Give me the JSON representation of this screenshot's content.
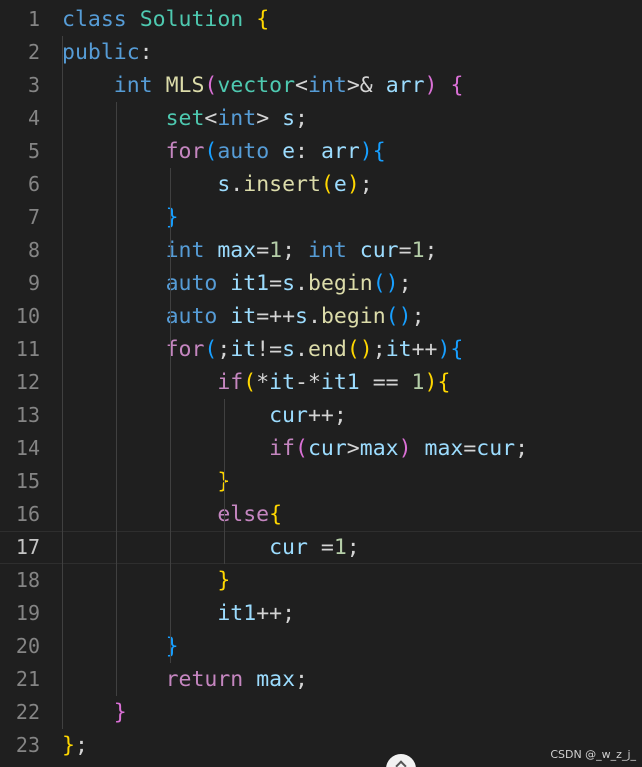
{
  "editor": {
    "current_line": 17,
    "lines": [
      {
        "n": "1",
        "tokens": [
          [
            "kw",
            "class"
          ],
          [
            "plain",
            " "
          ],
          [
            "ty",
            "Solution"
          ],
          [
            "plain",
            " "
          ],
          [
            "br1",
            "{"
          ]
        ]
      },
      {
        "n": "2",
        "tokens": [
          [
            "kw",
            "public"
          ],
          [
            "plain",
            ":"
          ]
        ]
      },
      {
        "n": "3",
        "tokens": [
          [
            "plain",
            "    "
          ],
          [
            "kw",
            "int"
          ],
          [
            "plain",
            " "
          ],
          [
            "fn",
            "MLS"
          ],
          [
            "br2",
            "("
          ],
          [
            "ty",
            "vector"
          ],
          [
            "plain",
            "<"
          ],
          [
            "kw",
            "int"
          ],
          [
            "plain",
            ">& "
          ],
          [
            "var",
            "arr"
          ],
          [
            "br2",
            ")"
          ],
          [
            "plain",
            " "
          ],
          [
            "br2",
            "{"
          ]
        ]
      },
      {
        "n": "4",
        "tokens": [
          [
            "plain",
            "        "
          ],
          [
            "ty",
            "set"
          ],
          [
            "plain",
            "<"
          ],
          [
            "kw",
            "int"
          ],
          [
            "plain",
            "> "
          ],
          [
            "var",
            "s"
          ],
          [
            "plain",
            ";"
          ]
        ]
      },
      {
        "n": "5",
        "tokens": [
          [
            "plain",
            "        "
          ],
          [
            "ctl",
            "for"
          ],
          [
            "br3",
            "("
          ],
          [
            "kw",
            "auto"
          ],
          [
            "plain",
            " "
          ],
          [
            "var",
            "e"
          ],
          [
            "plain",
            ": "
          ],
          [
            "var",
            "arr"
          ],
          [
            "br3",
            ")"
          ],
          [
            "br3",
            "{"
          ]
        ]
      },
      {
        "n": "6",
        "tokens": [
          [
            "plain",
            "            "
          ],
          [
            "var",
            "s"
          ],
          [
            "plain",
            "."
          ],
          [
            "fn",
            "insert"
          ],
          [
            "br1",
            "("
          ],
          [
            "var",
            "e"
          ],
          [
            "br1",
            ")"
          ],
          [
            "plain",
            ";"
          ]
        ]
      },
      {
        "n": "7",
        "tokens": [
          [
            "plain",
            "        "
          ],
          [
            "br3",
            "}"
          ]
        ]
      },
      {
        "n": "8",
        "tokens": [
          [
            "plain",
            "        "
          ],
          [
            "kw",
            "int"
          ],
          [
            "plain",
            " "
          ],
          [
            "var",
            "max"
          ],
          [
            "plain",
            "="
          ],
          [
            "num",
            "1"
          ],
          [
            "plain",
            "; "
          ],
          [
            "kw",
            "int"
          ],
          [
            "plain",
            " "
          ],
          [
            "var",
            "cur"
          ],
          [
            "plain",
            "="
          ],
          [
            "num",
            "1"
          ],
          [
            "plain",
            ";"
          ]
        ]
      },
      {
        "n": "9",
        "tokens": [
          [
            "plain",
            "        "
          ],
          [
            "kw",
            "auto"
          ],
          [
            "plain",
            " "
          ],
          [
            "var",
            "it1"
          ],
          [
            "plain",
            "="
          ],
          [
            "var",
            "s"
          ],
          [
            "plain",
            "."
          ],
          [
            "fn",
            "begin"
          ],
          [
            "br3",
            "()"
          ],
          [
            "plain",
            ";"
          ]
        ]
      },
      {
        "n": "10",
        "tokens": [
          [
            "plain",
            "        "
          ],
          [
            "kw",
            "auto"
          ],
          [
            "plain",
            " "
          ],
          [
            "var",
            "it"
          ],
          [
            "plain",
            "=++"
          ],
          [
            "var",
            "s"
          ],
          [
            "plain",
            "."
          ],
          [
            "fn",
            "begin"
          ],
          [
            "br3",
            "()"
          ],
          [
            "plain",
            ";"
          ]
        ]
      },
      {
        "n": "11",
        "tokens": [
          [
            "plain",
            "        "
          ],
          [
            "ctl",
            "for"
          ],
          [
            "br3",
            "("
          ],
          [
            "plain",
            ";"
          ],
          [
            "var",
            "it"
          ],
          [
            "plain",
            "!="
          ],
          [
            "var",
            "s"
          ],
          [
            "plain",
            "."
          ],
          [
            "fn",
            "end"
          ],
          [
            "br1",
            "()"
          ],
          [
            "plain",
            ";"
          ],
          [
            "var",
            "it"
          ],
          [
            "plain",
            "++"
          ],
          [
            "br3",
            ")"
          ],
          [
            "br3",
            "{"
          ]
        ]
      },
      {
        "n": "12",
        "tokens": [
          [
            "plain",
            "            "
          ],
          [
            "ctl",
            "if"
          ],
          [
            "br1",
            "("
          ],
          [
            "plain",
            "*"
          ],
          [
            "var",
            "it"
          ],
          [
            "plain",
            "-*"
          ],
          [
            "var",
            "it1"
          ],
          [
            "plain",
            " == "
          ],
          [
            "num",
            "1"
          ],
          [
            "br1",
            ")"
          ],
          [
            "br1",
            "{"
          ]
        ]
      },
      {
        "n": "13",
        "tokens": [
          [
            "plain",
            "                "
          ],
          [
            "var",
            "cur"
          ],
          [
            "plain",
            "++;"
          ]
        ]
      },
      {
        "n": "14",
        "tokens": [
          [
            "plain",
            "                "
          ],
          [
            "ctl",
            "if"
          ],
          [
            "br2",
            "("
          ],
          [
            "var",
            "cur"
          ],
          [
            "plain",
            ">"
          ],
          [
            "var",
            "max"
          ],
          [
            "br2",
            ")"
          ],
          [
            "plain",
            " "
          ],
          [
            "var",
            "max"
          ],
          [
            "plain",
            "="
          ],
          [
            "var",
            "cur"
          ],
          [
            "plain",
            ";"
          ]
        ]
      },
      {
        "n": "15",
        "tokens": [
          [
            "plain",
            "            "
          ],
          [
            "br1",
            "}"
          ]
        ]
      },
      {
        "n": "16",
        "tokens": [
          [
            "plain",
            "            "
          ],
          [
            "ctl",
            "else"
          ],
          [
            "br1",
            "{"
          ]
        ]
      },
      {
        "n": "17",
        "tokens": [
          [
            "plain",
            "                "
          ],
          [
            "var",
            "cur"
          ],
          [
            "plain",
            " ="
          ],
          [
            "num",
            "1"
          ],
          [
            "plain",
            ";"
          ]
        ]
      },
      {
        "n": "18",
        "tokens": [
          [
            "plain",
            "            "
          ],
          [
            "br1",
            "}"
          ]
        ]
      },
      {
        "n": "19",
        "tokens": [
          [
            "plain",
            "            "
          ],
          [
            "var",
            "it1"
          ],
          [
            "plain",
            "++;"
          ]
        ]
      },
      {
        "n": "20",
        "tokens": [
          [
            "plain",
            "        "
          ],
          [
            "br3",
            "}"
          ]
        ]
      },
      {
        "n": "21",
        "tokens": [
          [
            "plain",
            "        "
          ],
          [
            "ctl",
            "return"
          ],
          [
            "plain",
            " "
          ],
          [
            "var",
            "max"
          ],
          [
            "plain",
            ";"
          ]
        ]
      },
      {
        "n": "22",
        "tokens": [
          [
            "plain",
            "    "
          ],
          [
            "br2",
            "}"
          ]
        ]
      },
      {
        "n": "23",
        "tokens": [
          [
            "br1",
            "}"
          ],
          [
            "plain",
            ";"
          ]
        ]
      }
    ]
  },
  "watermark": "CSDN @_w_z_j_",
  "scroll_icon": "chevron-up-icon"
}
